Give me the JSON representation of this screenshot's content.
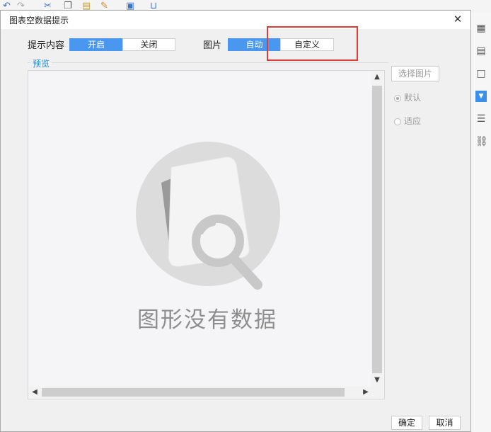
{
  "app": {
    "toolbar_icons": [
      "undo-icon",
      "redo-icon",
      "cut-icon",
      "copy-icon",
      "paste-icon",
      "format-painter-icon",
      "insert-text-icon",
      "insert-cell-icon"
    ],
    "right_panel_icons": [
      "cell-attributes-icon",
      "widget-attributes-icon",
      "frame-icon",
      "chart-attributes-icon",
      "condition-attributes-icon",
      "hyperlink-icon"
    ]
  },
  "dialog": {
    "title": "图表空数据提示",
    "close_glyph": "✕"
  },
  "prompt_content": {
    "label": "提示内容",
    "options": [
      "开启",
      "关闭"
    ],
    "selected": "开启"
  },
  "image_setting": {
    "label": "图片",
    "options": [
      "自动",
      "自定义"
    ],
    "selected": "自动"
  },
  "preview": {
    "group_label": "预览",
    "empty_text": "图形没有数据"
  },
  "side_options": {
    "select_image_button": "选择图片",
    "radio_default": "默认",
    "radio_fit": "适应",
    "radio_selected": "默认"
  },
  "buttons": {
    "ok": "确定",
    "cancel": "取消"
  },
  "colors": {
    "accent": "#4a97ef",
    "highlight_box": "#e23a35",
    "group_label": "#2a89c8",
    "placeholder_gray": "#8e8e8e"
  }
}
